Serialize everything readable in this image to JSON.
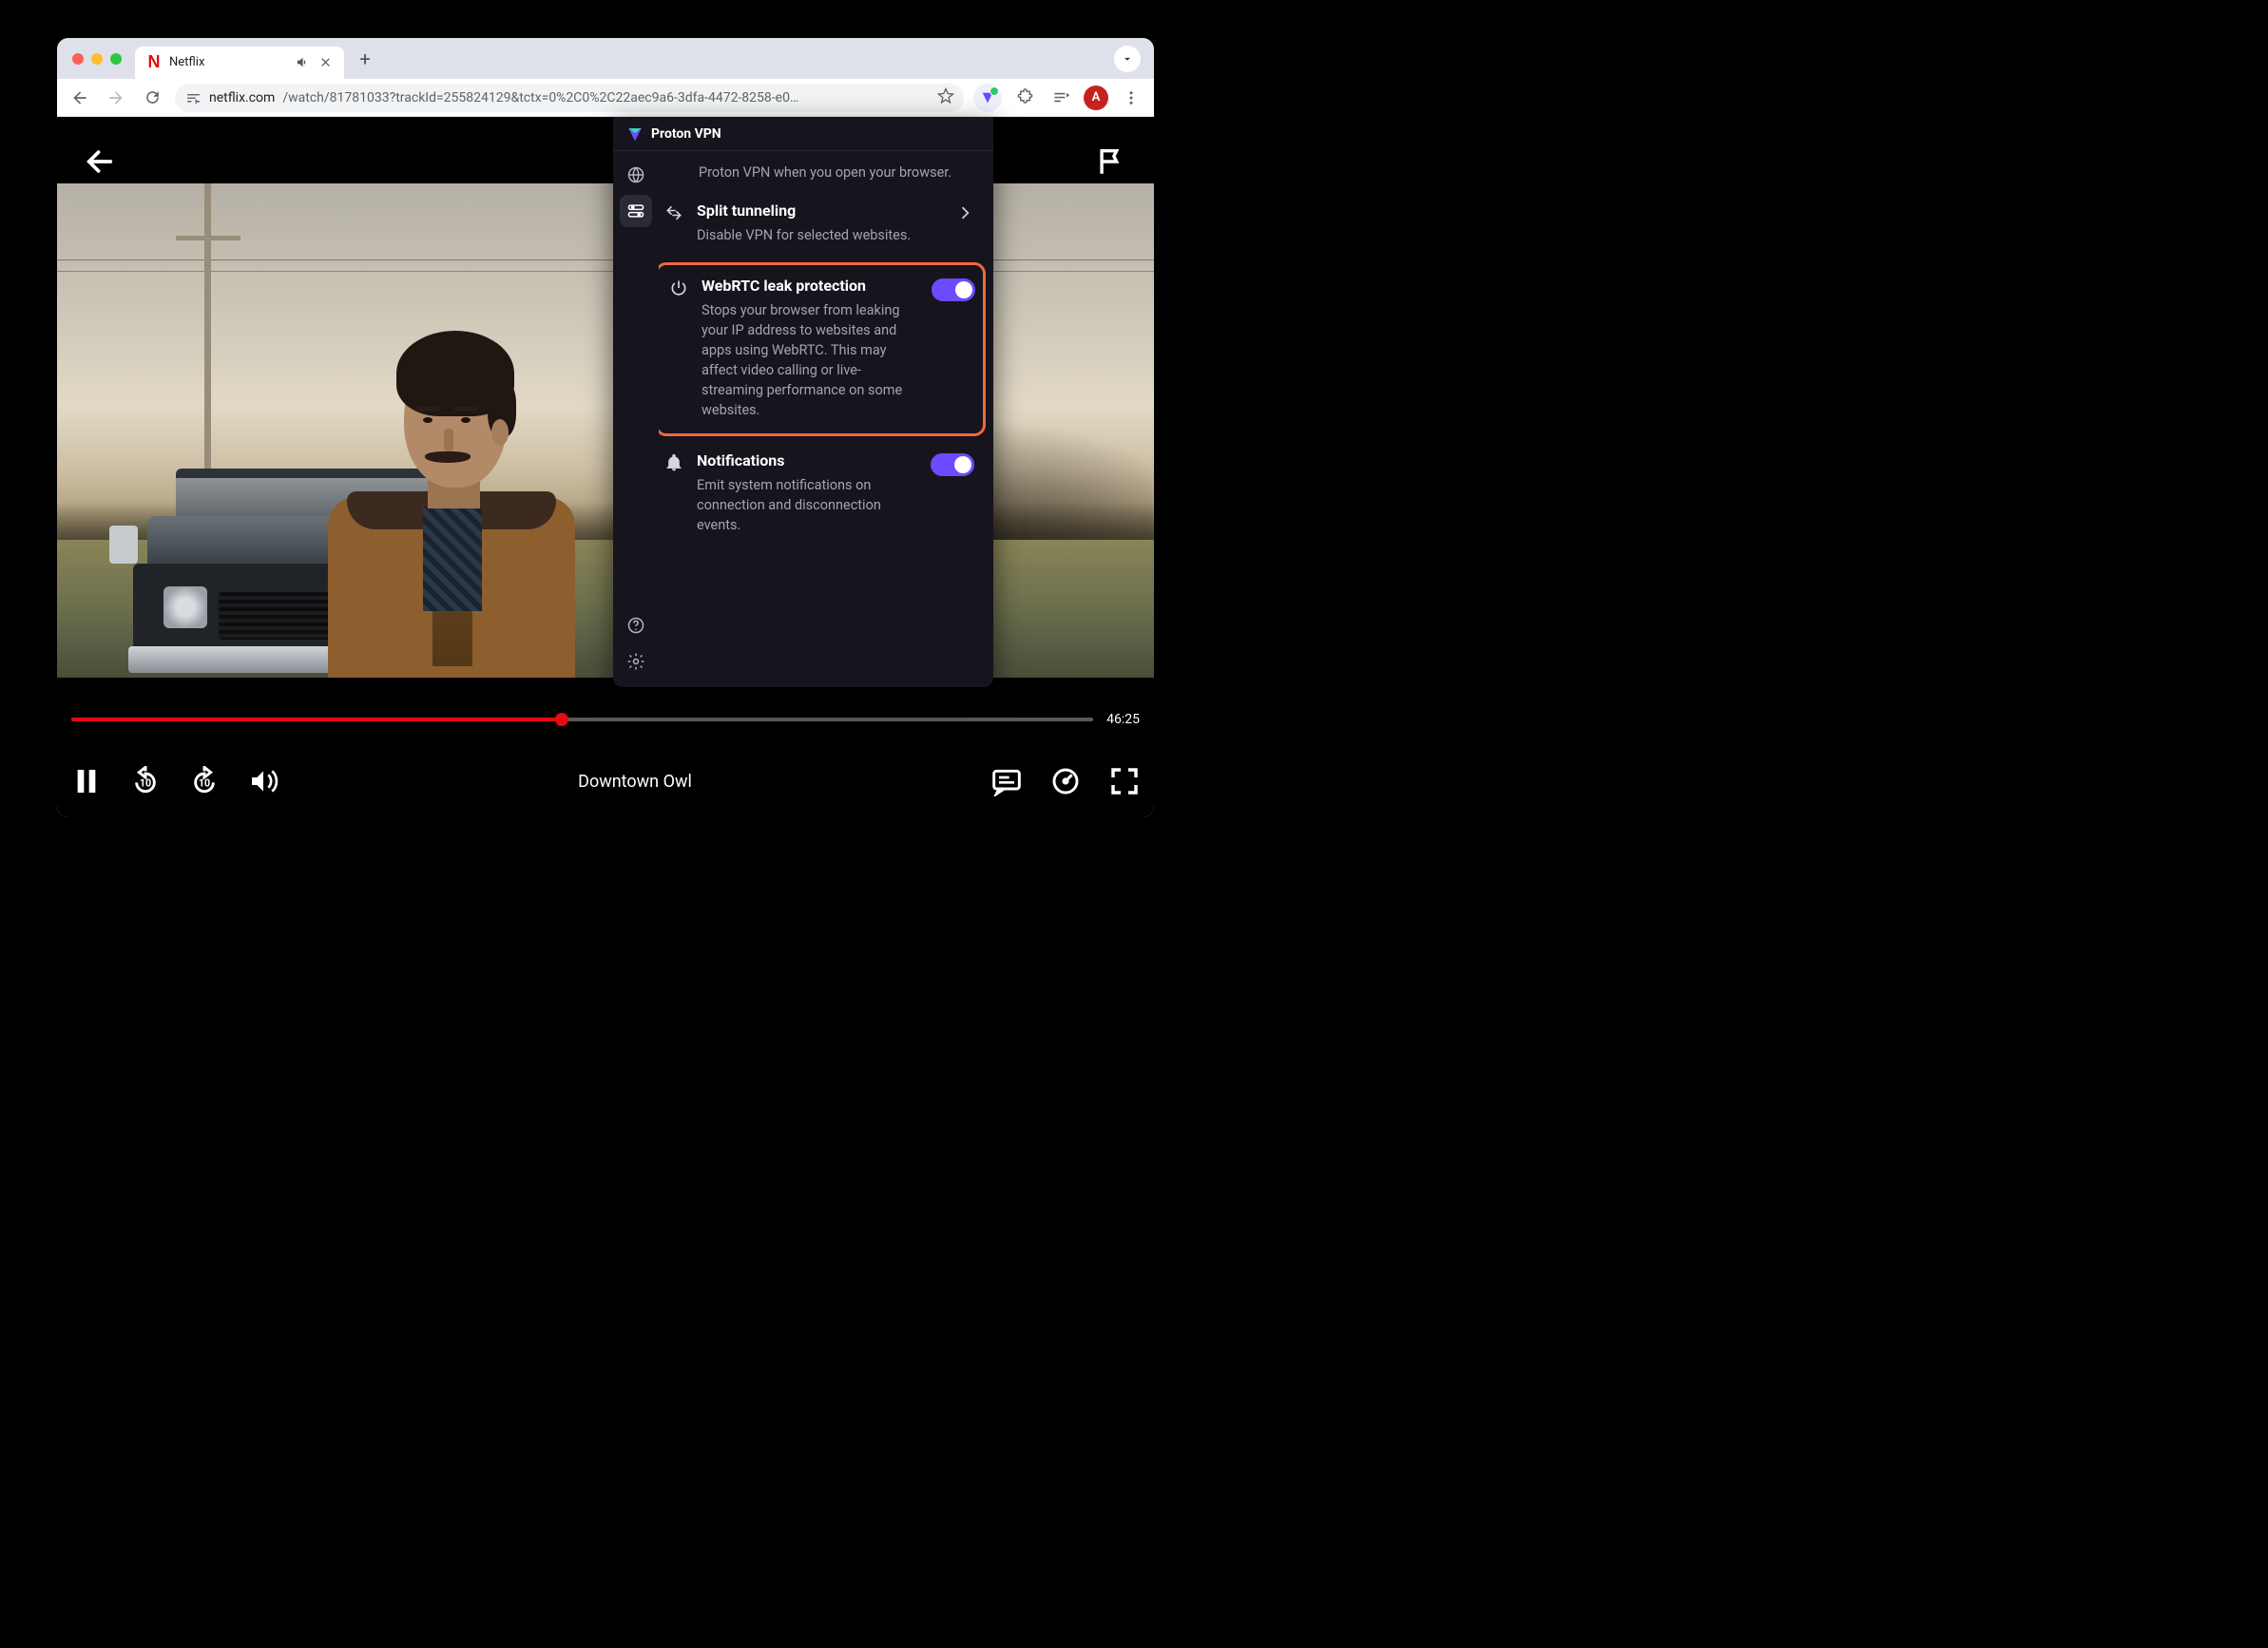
{
  "browser": {
    "tab": {
      "title": "Netflix",
      "favicon_letter": "N"
    },
    "url_domain": "netflix.com",
    "url_path": "/watch/81781033?trackId=255824129&tctx=0%2C0%2C22aec9a6-3dfa-4472-8258-e0…",
    "avatar_letter": "A"
  },
  "player": {
    "title": "Downtown Owl",
    "time_remaining": "46:25",
    "progress_pct": 48,
    "rewind_secs": "10",
    "forward_secs": "10"
  },
  "ext": {
    "name": "Proton VPN",
    "partial_setting_tail": "Proton VPN when you open your browser.",
    "settings": [
      {
        "key": "split_tunneling",
        "icon": "split",
        "title": "Split tunneling",
        "desc": "Disable VPN for selected websites.",
        "right": "chevron",
        "highlight": false
      },
      {
        "key": "webrtc",
        "icon": "power",
        "title": "WebRTC leak protection",
        "desc": "Stops your browser from leaking your IP address to websites and apps using WebRTC. This may affect video calling or live-streaming performance on some websites.",
        "right": "toggle",
        "highlight": true
      },
      {
        "key": "notifications",
        "icon": "bell",
        "title": "Notifications",
        "desc": "Emit system notifications on connection and disconnection events.",
        "right": "toggle",
        "highlight": false
      }
    ]
  }
}
